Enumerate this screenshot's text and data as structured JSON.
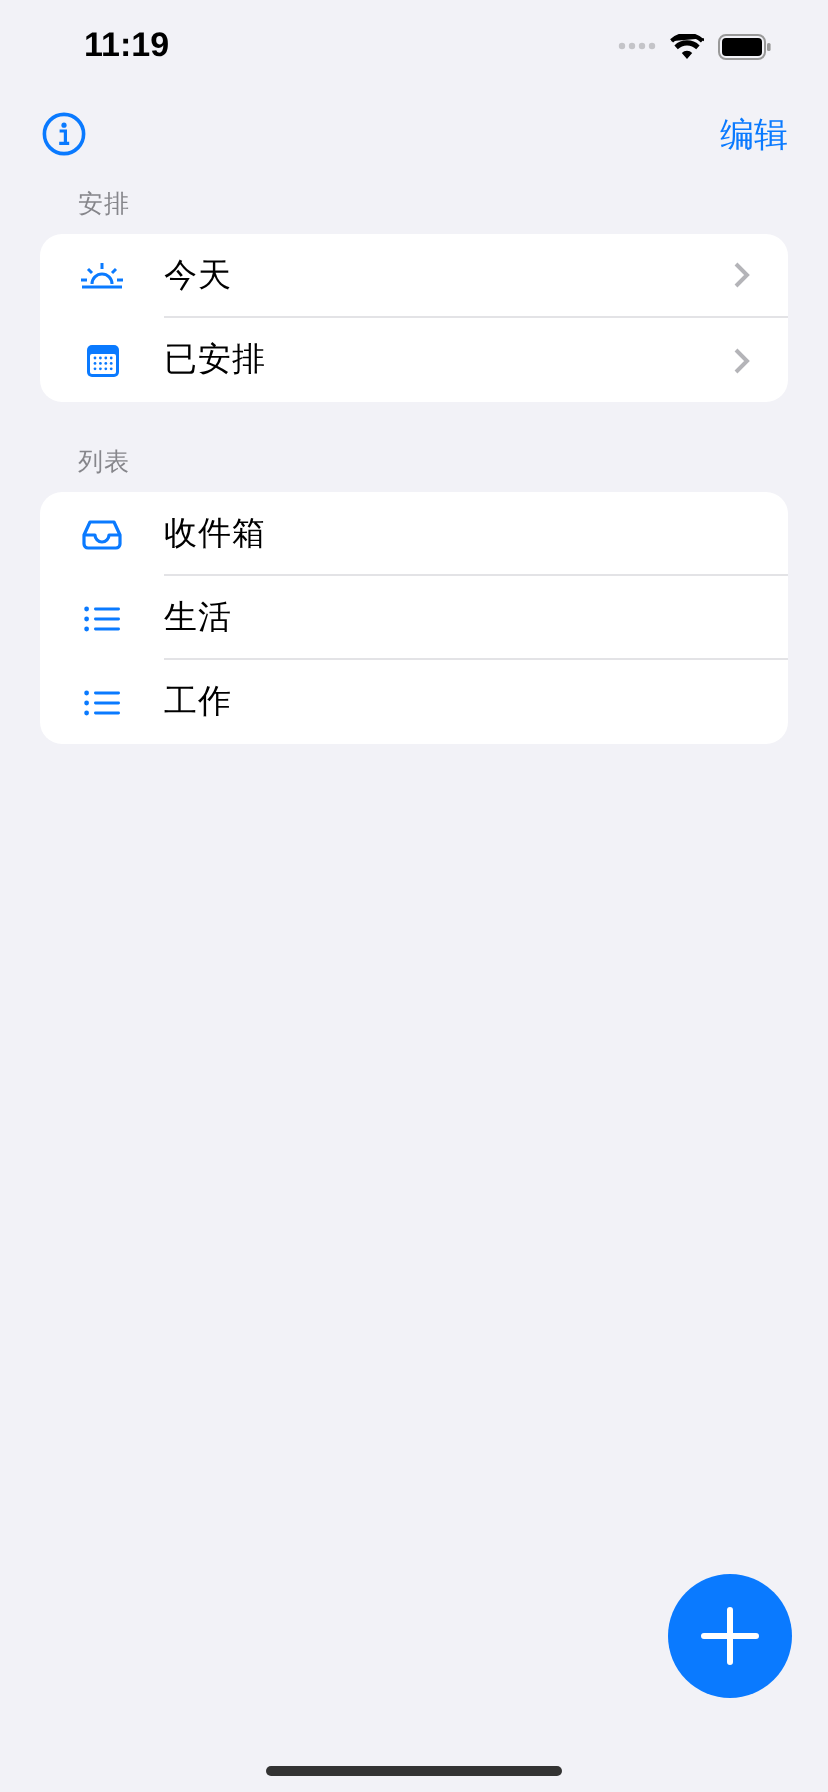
{
  "status_bar": {
    "time": "11:19"
  },
  "nav": {
    "edit": "编辑"
  },
  "sections": [
    {
      "header": "安排",
      "items": [
        {
          "label": "今天",
          "kind": "sunrise",
          "disclosure": true
        },
        {
          "label": "已安排",
          "kind": "calendar",
          "disclosure": true
        }
      ]
    },
    {
      "header": "列表",
      "items": [
        {
          "label": "收件箱",
          "kind": "inbox",
          "disclosure": false
        },
        {
          "label": "生活",
          "kind": "list",
          "disclosure": false
        },
        {
          "label": "工作",
          "kind": "list",
          "disclosure": false
        }
      ]
    }
  ]
}
